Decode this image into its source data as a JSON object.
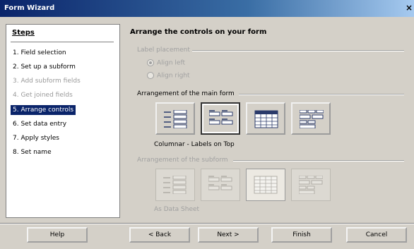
{
  "window": {
    "title": "Form Wizard",
    "close_glyph": "×"
  },
  "steps": {
    "heading": "Steps",
    "items": [
      {
        "label": "1. Field selection",
        "state": "normal"
      },
      {
        "label": "2. Set up a subform",
        "state": "normal"
      },
      {
        "label": "3. Add subform fields",
        "state": "disabled"
      },
      {
        "label": "4. Get joined fields",
        "state": "disabled"
      },
      {
        "label": "5. Arrange controls",
        "state": "active"
      },
      {
        "label": "6. Set data entry",
        "state": "normal"
      },
      {
        "label": "7. Apply styles",
        "state": "normal"
      },
      {
        "label": "8. Set name",
        "state": "normal"
      }
    ]
  },
  "main": {
    "heading": "Arrange the controls on your form",
    "label_placement": {
      "title": "Label placement",
      "align_left": "Align left",
      "align_right": "Align right",
      "selected": "align_left"
    },
    "main_form": {
      "title": "Arrangement of the main form",
      "options": [
        "Columnar - Labels Left",
        "Columnar - Labels on Top",
        "As Data Sheet",
        "In Blocks - Labels Above"
      ],
      "selected_index": 1,
      "caption": "Columnar - Labels on Top"
    },
    "subform": {
      "title": "Arrangement of the subform",
      "selected_index": 2,
      "caption": "As Data Sheet"
    }
  },
  "buttons": {
    "help": "Help",
    "back": "< Back",
    "next": "Next >",
    "finish": "Finish",
    "cancel": "Cancel"
  },
  "colors": {
    "title_bar": "#0a246a",
    "active_step": "#0a246a",
    "dialog_bg": "#d4d0c8"
  }
}
